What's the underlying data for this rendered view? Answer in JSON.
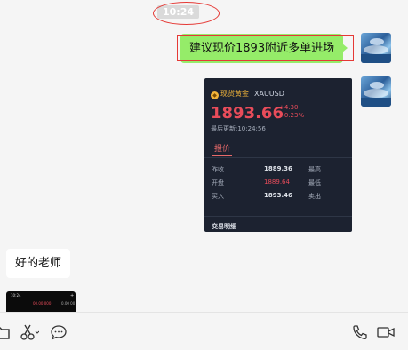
{
  "chat": {
    "timestamp": "10:24",
    "outgoing_message": "建议现价1893附近多单进场",
    "incoming_message": "好的老师"
  },
  "quote_card": {
    "name": "现货黄金",
    "symbol": "XAUUSD",
    "price": "1893.66",
    "change": "+4.30",
    "change_pct": "+0.23%",
    "updated": "最后更新:10:24:56",
    "tab": "报价",
    "rows": [
      {
        "label": "昨收",
        "value": "1889.36",
        "label2": "最高"
      },
      {
        "label": "开盘",
        "value": "1889.64",
        "label2": "最低"
      },
      {
        "label": "买入",
        "value": "1893.46",
        "label2": "卖出"
      }
    ],
    "footer": "交易明细"
  },
  "thumbnail": {
    "time": "10:24",
    "value": "00.00 000",
    "extra": "0.00 00",
    "plus": "+"
  },
  "colors": {
    "outgoing_bubble": "#95ec69",
    "incoming_bubble": "#ffffff",
    "price_red": "#e84c5a",
    "gold": "#f3b53a",
    "card_bg": "#1c2230",
    "annotation_red": "#e53935"
  },
  "icons": {
    "toolbar_left": [
      "folder-icon",
      "scissors-icon",
      "chat-bubble-icon"
    ],
    "toolbar_right": [
      "phone-icon",
      "video-icon"
    ]
  }
}
